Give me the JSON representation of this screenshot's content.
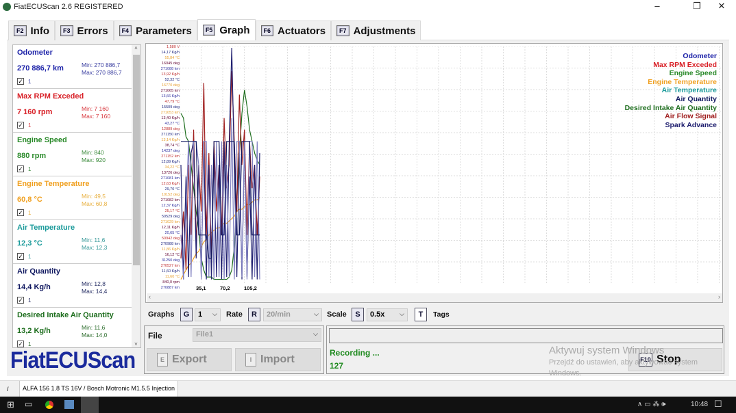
{
  "window": {
    "title": "FiatECUScan 2.6 REGISTERED",
    "min": "–",
    "max": "❐",
    "close": "✕"
  },
  "tabs": [
    {
      "key": "F2",
      "label": "Info"
    },
    {
      "key": "F3",
      "label": "Errors"
    },
    {
      "key": "F4",
      "label": "Parameters"
    },
    {
      "key": "F5",
      "label": "Graph",
      "active": true
    },
    {
      "key": "F6",
      "label": "Actuators"
    },
    {
      "key": "F7",
      "label": "Adjustments"
    }
  ],
  "params": [
    {
      "name": "Odometer",
      "value": "270 886,7 km",
      "min": "Min: 270 886,7",
      "max": "Max: 270 886,7",
      "count": "1",
      "color": "#1c22a8",
      "sub": "#3a3ea0"
    },
    {
      "name": "Max RPM Exceded",
      "value": "7 160 rpm",
      "min": "Min: 7 160",
      "max": "Max: 7 160",
      "count": "1",
      "color": "#d81f26",
      "sub": "#d83a40"
    },
    {
      "name": "Engine Speed",
      "value": "880 rpm",
      "min": "Min: 840",
      "max": "Max: 920",
      "count": "1",
      "color": "#2a8a2a",
      "sub": "#3a8a3a"
    },
    {
      "name": "Engine Temperature",
      "value": "60,8 °C",
      "min": "Min: 49,5",
      "max": "Max: 60,8",
      "count": "1",
      "color": "#f0a020",
      "sub": "#e8b040"
    },
    {
      "name": "Air Temperature",
      "value": "12,3 °C",
      "min": "Min: 11,6",
      "max": "Max: 12,3",
      "count": "1",
      "color": "#1a9a9a",
      "sub": "#3a9a9a"
    },
    {
      "name": "Air Quantity",
      "value": "14,4 Kg/h",
      "min": "Min: 12,8",
      "max": "Max: 14,4",
      "count": "1",
      "color": "#101860",
      "sub": "#202860"
    },
    {
      "name": "Desired Intake Air Quantity",
      "value": "13,2 Kg/h",
      "min": "Min: 11,6",
      "max": "Max: 14,0",
      "count": "1",
      "color": "#1e6e1e",
      "sub": "#2e6e2e"
    }
  ],
  "logo": "FiatECUScan",
  "axis_labels": [
    "1,580 V",
    "14,17 Kg/h",
    "55,84 °C",
    "16045 deg",
    "271088 km",
    "13,92 Kg/h",
    "52,32 °C",
    "16770 deg",
    "271065 km",
    "13,66 Kg/h",
    "47,79 °C",
    "15509 deg",
    "271053 km",
    "13,40 Kg/h",
    "43,27 °C",
    "12889 deg",
    "271150 km",
    "13,14 Kg/h",
    "38,74 °C",
    "14237 deg",
    "271152 km",
    "12,89 Kg/h",
    "34,22 °C",
    "13726 deg",
    "271081 km",
    "12,63 Kg/h",
    "29,70 °C",
    "10152 deg",
    "271082 km",
    "12,37 Kg/h",
    "25,17 °C",
    "50529 deg",
    "271029 km",
    "12,11 Kg/h",
    "20,65 °C",
    "50942 deg",
    "270988 km",
    "11,86 Kg/h",
    "16,12 °C",
    "31250 deg",
    "270527 km",
    "11,60 Kg/h",
    "11,60 °C",
    "840,0 rpm",
    "270887 km"
  ],
  "axis_colors": [
    "#c03030",
    "#202880",
    "#e8a030",
    "#600030",
    "#3030a0"
  ],
  "x_ticks": [
    "35,1",
    "70,2",
    "105,2"
  ],
  "legend": [
    {
      "label": "Odometer",
      "color": "#1c22a8"
    },
    {
      "label": "Max RPM Exceded",
      "color": "#d81f26"
    },
    {
      "label": "Engine Speed",
      "color": "#2a8a2a"
    },
    {
      "label": "Engine Temperature",
      "color": "#f0a020"
    },
    {
      "label": "Air Temperature",
      "color": "#1a9a9a"
    },
    {
      "label": "Air Quantity",
      "color": "#101860"
    },
    {
      "label": "Desired Intake Air Quantity",
      "color": "#1e6e1e"
    },
    {
      "label": "Air Flow Signal",
      "color": "#a02020"
    },
    {
      "label": "Spark Advance",
      "color": "#202070"
    }
  ],
  "series": [
    {
      "color": "#1e6e1e",
      "values": [
        0.72,
        0.7,
        0.62,
        0.6,
        0.5,
        0.4,
        0.3,
        0.22,
        0.1,
        0.05,
        0.02,
        0.02,
        0.02,
        0.01,
        0.01,
        0.01,
        0.01,
        0.01,
        0.01,
        0.02,
        0.05,
        0.15,
        0.35,
        0.55,
        0.72,
        0.82,
        0.75,
        0.65,
        0.6,
        0.55,
        0.52,
        0.5
      ]
    },
    {
      "color": "#f0a020",
      "values": [
        0.01,
        0.03,
        0.05,
        0.07,
        0.08,
        0.1,
        0.12,
        0.13,
        0.15,
        0.17,
        0.18,
        0.2,
        0.21,
        0.22,
        0.23,
        0.23,
        0.24,
        0.25,
        0.25,
        0.26,
        0.27,
        0.28,
        0.3,
        0.31,
        0.31,
        0.32,
        0.33,
        0.33,
        0.34,
        0.35,
        0.35,
        0.36
      ]
    },
    {
      "color": "#a02020",
      "values": [
        0.1,
        0.3,
        0.05,
        0.5,
        0.2,
        0.65,
        0.15,
        0.5,
        0.3,
        0.85,
        0.2,
        0.55,
        0.1,
        0.6,
        0.3,
        0.5,
        0.2,
        0.7,
        0.4,
        0.5,
        0.9,
        0.6,
        0.3,
        0.8,
        0.5,
        0.65,
        0.2,
        0.6,
        0.4,
        0.5,
        0.2,
        0.45
      ]
    },
    {
      "color": "#202070",
      "values": [
        0.5,
        0.01,
        0.45,
        0.02,
        0.55,
        0.6,
        0.1,
        0.5,
        0.02,
        0.6,
        0.01,
        0.5,
        0.01,
        0.55,
        0.02,
        0.5,
        0.01,
        0.6,
        0.02,
        0.6,
        1.0,
        0.5,
        0.02,
        0.55,
        0.01,
        0.6,
        0.02,
        0.45,
        0.01,
        0.5,
        0.01,
        0.55
      ]
    },
    {
      "color": "#8080c0",
      "values": [
        0.2,
        0.01,
        0.3,
        0.6,
        0.02,
        0.6,
        0.6,
        0.5,
        0.01,
        0.6,
        0.6,
        0.02,
        0.5,
        0.01,
        0.6,
        0.02,
        0.6,
        0.01,
        0.5,
        0.02,
        0.7,
        0.01,
        0.6,
        0.6,
        0.02,
        0.6,
        0.01,
        0.6,
        0.6,
        0.02,
        0.6,
        0.01
      ]
    },
    {
      "color": "#101860",
      "values": [
        0.6,
        0.6,
        0.6,
        0.6,
        0.6,
        0.6,
        0.6,
        0.2,
        0.2,
        0.2,
        0.2,
        0.1,
        0.1,
        0.6,
        0.6,
        0.6,
        0.2,
        0.2,
        0.6,
        0.6,
        0.6,
        0.6,
        0.2,
        0.2,
        0.6,
        0.6,
        0.6,
        0.6,
        0.2,
        0.2,
        0.2,
        0.2
      ]
    }
  ],
  "controls": {
    "graphs_label": "Graphs",
    "graphs_key": "G",
    "graphs_value": "1",
    "rate_label": "Rate",
    "rate_key": "R",
    "rate_value": "20/min",
    "scale_label": "Scale",
    "scale_key": "S",
    "scale_value": "0.5x",
    "tags_key": "T",
    "tags_label": "Tags"
  },
  "file": {
    "label": "File",
    "value": "File1",
    "export_key": "E",
    "export": "Export",
    "import_key": "I",
    "import": "Import"
  },
  "recording": {
    "status": "Recording ...",
    "count": "127",
    "stop_key": "F10",
    "stop": "Stop"
  },
  "watermark": {
    "title": "Aktywuj system Windows",
    "sub": "Przejdź do ustawień, aby aktywować system",
    "sub2": "Windows."
  },
  "statusbar": {
    "sep": "/",
    "vehicle": "ALFA 156 1.8 TS 16V / Bosch Motronic M1.5.5 Injection"
  },
  "taskbar": {
    "time": "10:48",
    "tray": "∧ ▭ ⁂ 🕪"
  }
}
